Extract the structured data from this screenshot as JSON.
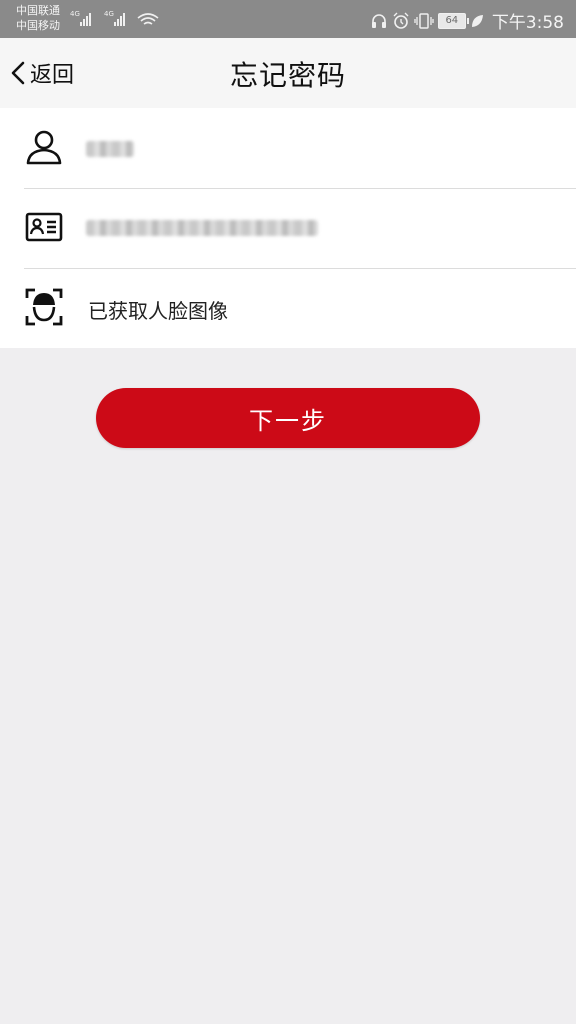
{
  "status_bar": {
    "carrier_1": "中国联通",
    "carrier_2": "中国移动",
    "network_1": "4G",
    "network_2": "4G",
    "battery": "64",
    "time": "下午3:58"
  },
  "nav": {
    "back_label": "返回",
    "title": "忘记密码"
  },
  "form": {
    "rows": [
      {
        "icon": "user-icon",
        "value": ""
      },
      {
        "icon": "id-card-icon",
        "value": ""
      },
      {
        "icon": "face-scan-icon",
        "value": "已获取人脸图像"
      }
    ]
  },
  "actions": {
    "next_label": "下一步"
  },
  "colors": {
    "accent": "#cc0a17",
    "page_background": "#efeef0",
    "status_bar": "#8a8a8a"
  }
}
